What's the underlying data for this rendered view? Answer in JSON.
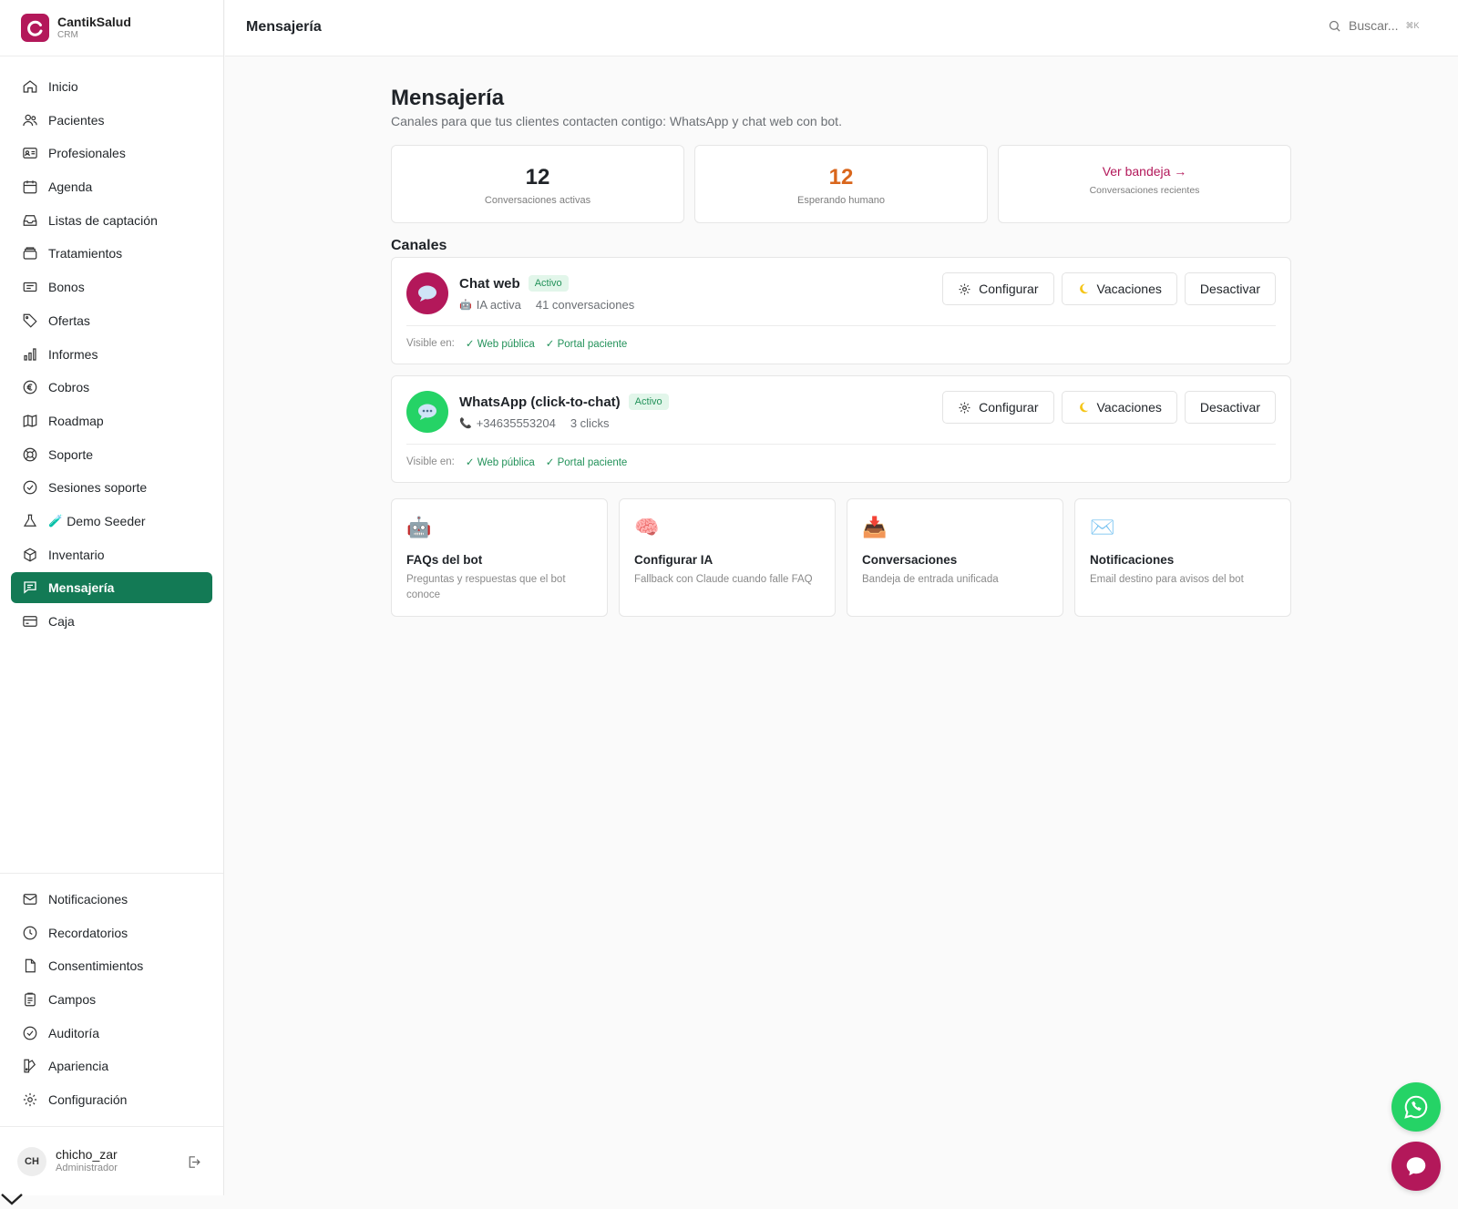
{
  "brand": {
    "name": "CantikSalud",
    "sub": "CRM"
  },
  "nav": [
    {
      "label": "Inicio",
      "icon": "home-icon"
    },
    {
      "label": "Pacientes",
      "icon": "users-icon"
    },
    {
      "label": "Profesionales",
      "icon": "id-card-icon"
    },
    {
      "label": "Agenda",
      "icon": "calendar-icon"
    },
    {
      "label": "Listas de captación",
      "icon": "inbox-icon"
    },
    {
      "label": "Tratamientos",
      "icon": "stack-icon"
    },
    {
      "label": "Bonos",
      "icon": "ticket-icon"
    },
    {
      "label": "Ofertas",
      "icon": "tag-icon"
    },
    {
      "label": "Informes",
      "icon": "bar-chart-icon"
    },
    {
      "label": "Cobros",
      "icon": "euro-icon"
    },
    {
      "label": "Roadmap",
      "icon": "map-icon"
    },
    {
      "label": "Soporte",
      "icon": "lifebuoy-icon"
    },
    {
      "label": "Sesiones soporte",
      "icon": "badge-check-icon"
    },
    {
      "label": "Demo Seeder",
      "prefix": "🧪",
      "icon": "flask-icon"
    },
    {
      "label": "Inventario",
      "icon": "package-icon"
    },
    {
      "label": "Mensajería",
      "icon": "chat-icon",
      "active": true
    },
    {
      "label": "Caja",
      "icon": "credit-card-icon"
    }
  ],
  "nav_bottom": [
    {
      "label": "Notificaciones",
      "icon": "mail-icon"
    },
    {
      "label": "Recordatorios",
      "icon": "clock-icon"
    },
    {
      "label": "Consentimientos",
      "icon": "file-icon"
    },
    {
      "label": "Campos",
      "icon": "clipboard-icon"
    },
    {
      "label": "Auditoría",
      "icon": "shield-check-icon"
    },
    {
      "label": "Apariencia",
      "icon": "palette-icon"
    },
    {
      "label": "Configuración",
      "icon": "gear-icon"
    }
  ],
  "user": {
    "initials": "CH",
    "name": "chicho_zar",
    "role": "Administrador"
  },
  "header": {
    "title": "Mensajería",
    "search_placeholder": "Buscar...",
    "shortcut": "⌘K"
  },
  "page": {
    "title": "Mensajería",
    "subtitle": "Canales para que tus clientes contacten contigo: WhatsApp y chat web con bot.",
    "section_title": "Canales"
  },
  "stats": [
    {
      "value": "12",
      "label": "Conversaciones activas",
      "color": "#1f2328"
    },
    {
      "value": "12",
      "label": "Esperando humano",
      "color": "#d9661c"
    },
    {
      "link": "Ver bandeja →",
      "label": "Conversaciones recientes"
    }
  ],
  "channels": [
    {
      "name": "Chat web",
      "status": "Activo",
      "meta_icon": "🤖",
      "meta1": "IA activa",
      "meta2": "41 conversaciones",
      "icon_bg": "#b3185a",
      "btn_config": "Configurar",
      "btn_vacation": "Vacaciones",
      "btn_disable": "Desactivar",
      "visible_label": "Visible en:",
      "visible": [
        "✓ Web pública",
        "✓ Portal paciente"
      ]
    },
    {
      "name": "WhatsApp (click-to-chat)",
      "status": "Activo",
      "meta_icon": "📞",
      "meta1": "+34635553204",
      "meta2": "3 clicks",
      "icon_bg": "#25d366",
      "btn_config": "Configurar",
      "btn_vacation": "Vacaciones",
      "btn_disable": "Desactivar",
      "visible_label": "Visible en:",
      "visible": [
        "✓ Web pública",
        "✓ Portal paciente"
      ]
    }
  ],
  "tiles": [
    {
      "emoji": "🤖",
      "title": "FAQs del bot",
      "desc": "Preguntas y respuestas que el bot conoce"
    },
    {
      "emoji": "🧠",
      "title": "Configurar IA",
      "desc": "Fallback con Claude cuando falle FAQ"
    },
    {
      "emoji": "📥",
      "title": "Conversaciones",
      "desc": "Bandeja de entrada unificada"
    },
    {
      "emoji": "✉️",
      "title": "Notificaciones",
      "desc": "Email destino para avisos del bot"
    }
  ],
  "colors": {
    "accent": "#137a55",
    "brand": "#b3185a",
    "whatsapp": "#25d366"
  }
}
